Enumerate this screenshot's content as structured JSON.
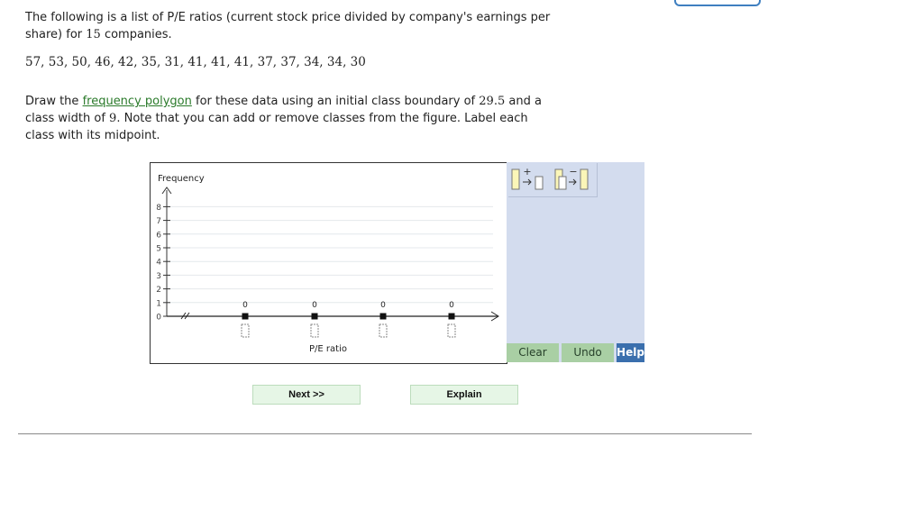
{
  "problem": {
    "intro_text": "The following is a list of P/E ratios (current stock price divided by company's earnings per share) for",
    "intro_count": "15",
    "intro_suffix": "companies.",
    "data_values": "57, 53, 50, 46, 42, 35, 31, 41, 41, 41, 37, 37, 34, 34, 30",
    "instr_part1": "Draw the",
    "instr_link": "frequency polygon",
    "instr_part2": "for these data using an initial class boundary of",
    "boundary": "29.5",
    "instr_part3": "and a class width of",
    "width": "9",
    "instr_part4": ". Note that you can add or remove classes from the figure. Label each class with its midpoint."
  },
  "graph": {
    "y_axis_label": "Frequency",
    "x_axis_label": "P/E ratio",
    "y_ticks": [
      "0",
      "1",
      "2",
      "3",
      "4",
      "5",
      "6",
      "7",
      "8"
    ],
    "class_points": [
      {
        "frequency": "0",
        "midpoint": ""
      },
      {
        "frequency": "0",
        "midpoint": ""
      },
      {
        "frequency": "0",
        "midpoint": ""
      },
      {
        "frequency": "0",
        "midpoint": ""
      }
    ]
  },
  "toolbar": {
    "add_class_icon": "add-class-icon",
    "remove_class_icon": "remove-class-icon",
    "clear_label": "Clear",
    "undo_label": "Undo",
    "help_label": "Help"
  },
  "nav": {
    "next_label": "Next >>",
    "explain_label": "Explain"
  }
}
